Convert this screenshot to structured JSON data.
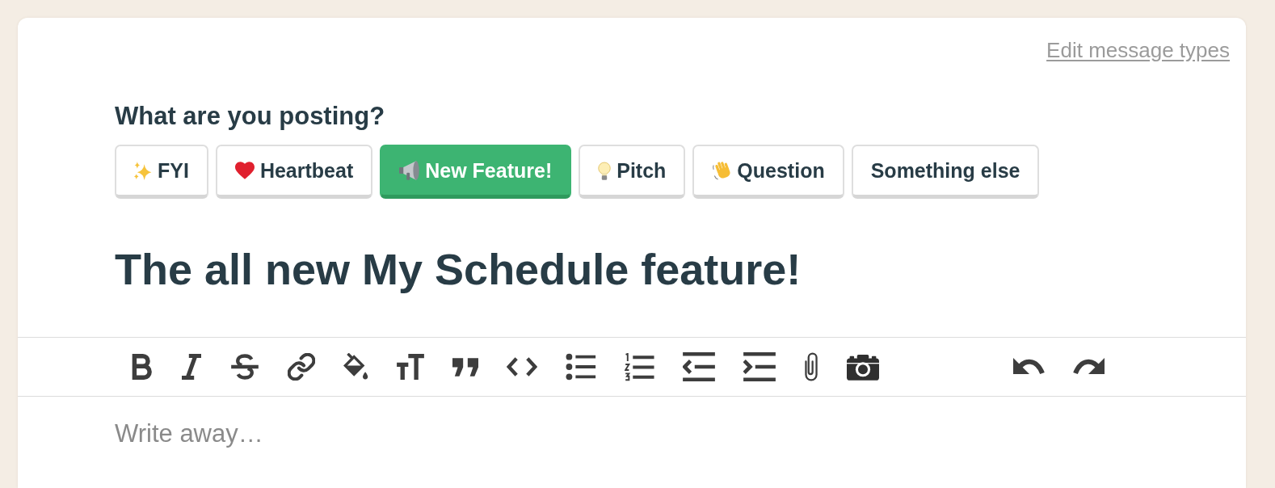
{
  "header": {
    "link": "Edit message types"
  },
  "composer": {
    "prompt": "What are you posting?",
    "message_types": [
      {
        "label": "FYI",
        "selected": false
      },
      {
        "label": "Heartbeat",
        "selected": false
      },
      {
        "label": "New Feature!",
        "selected": true
      },
      {
        "label": "Pitch",
        "selected": false
      },
      {
        "label": "Question",
        "selected": false
      },
      {
        "label": "Something else",
        "selected": false
      }
    ],
    "title": {
      "value": "The all new My Schedule feature!"
    },
    "editor": {
      "placeholder": "Write away…"
    }
  }
}
